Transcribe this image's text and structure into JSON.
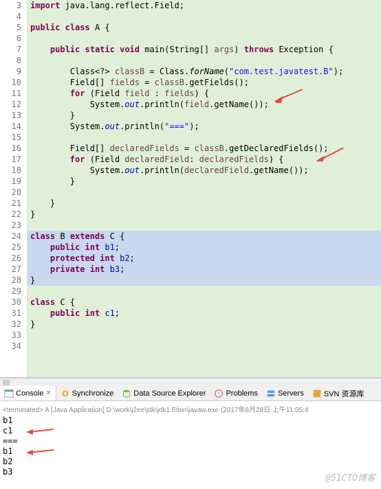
{
  "code": {
    "lines": [
      {
        "n": 3,
        "t": [
          {
            "c": "kw",
            "s": "import"
          },
          {
            "c": "",
            "s": " java.lang.reflect.Field;"
          }
        ]
      },
      {
        "n": 4,
        "t": []
      },
      {
        "n": 5,
        "t": [
          {
            "c": "kw",
            "s": "public"
          },
          {
            "c": "",
            "s": " "
          },
          {
            "c": "kw",
            "s": "class"
          },
          {
            "c": "",
            "s": " A {"
          }
        ]
      },
      {
        "n": 6,
        "t": []
      },
      {
        "n": 7,
        "t": [
          {
            "c": "",
            "s": "    "
          },
          {
            "c": "kw",
            "s": "public"
          },
          {
            "c": "",
            "s": " "
          },
          {
            "c": "kw",
            "s": "static"
          },
          {
            "c": "",
            "s": " "
          },
          {
            "c": "kw",
            "s": "void"
          },
          {
            "c": "",
            "s": " main(String[] "
          },
          {
            "c": "var",
            "s": "args"
          },
          {
            "c": "",
            "s": ") "
          },
          {
            "c": "kw",
            "s": "throws"
          },
          {
            "c": "",
            "s": " Exception {"
          }
        ]
      },
      {
        "n": 8,
        "t": []
      },
      {
        "n": 9,
        "t": [
          {
            "c": "",
            "s": "        Class<?> "
          },
          {
            "c": "var",
            "s": "classB"
          },
          {
            "c": "",
            "s": " = Class."
          },
          {
            "c": "method",
            "s": "forName"
          },
          {
            "c": "",
            "s": "("
          },
          {
            "c": "str",
            "s": "\"com.test.javatest.B\""
          },
          {
            "c": "",
            "s": ");"
          }
        ]
      },
      {
        "n": 10,
        "t": [
          {
            "c": "",
            "s": "        Field[] "
          },
          {
            "c": "var",
            "s": "fields"
          },
          {
            "c": "",
            "s": " = "
          },
          {
            "c": "var",
            "s": "classB"
          },
          {
            "c": "",
            "s": ".getFields();"
          }
        ]
      },
      {
        "n": 11,
        "t": [
          {
            "c": "",
            "s": "        "
          },
          {
            "c": "kw",
            "s": "for"
          },
          {
            "c": "",
            "s": " (Field "
          },
          {
            "c": "var",
            "s": "field"
          },
          {
            "c": "",
            "s": " : "
          },
          {
            "c": "var",
            "s": "fields"
          },
          {
            "c": "",
            "s": ") {"
          }
        ]
      },
      {
        "n": 12,
        "t": [
          {
            "c": "",
            "s": "            System."
          },
          {
            "c": "static",
            "s": "out"
          },
          {
            "c": "",
            "s": ".println("
          },
          {
            "c": "var",
            "s": "field"
          },
          {
            "c": "",
            "s": ".getName());"
          }
        ]
      },
      {
        "n": 13,
        "t": [
          {
            "c": "",
            "s": "        }"
          }
        ]
      },
      {
        "n": 14,
        "t": [
          {
            "c": "",
            "s": "        System."
          },
          {
            "c": "static",
            "s": "out"
          },
          {
            "c": "",
            "s": ".println("
          },
          {
            "c": "str",
            "s": "\"===\""
          },
          {
            "c": "",
            "s": ");"
          }
        ]
      },
      {
        "n": 15,
        "t": []
      },
      {
        "n": 16,
        "t": [
          {
            "c": "",
            "s": "        Field[] "
          },
          {
            "c": "var",
            "s": "declaredFields"
          },
          {
            "c": "",
            "s": " = "
          },
          {
            "c": "var",
            "s": "classB"
          },
          {
            "c": "",
            "s": ".getDeclaredFields();"
          }
        ]
      },
      {
        "n": 17,
        "t": [
          {
            "c": "",
            "s": "        "
          },
          {
            "c": "kw",
            "s": "for"
          },
          {
            "c": "",
            "s": " (Field "
          },
          {
            "c": "var",
            "s": "declaredField"
          },
          {
            "c": "",
            "s": ": "
          },
          {
            "c": "var",
            "s": "declaredFields"
          },
          {
            "c": "",
            "s": ") {"
          }
        ]
      },
      {
        "n": 18,
        "t": [
          {
            "c": "",
            "s": "            System."
          },
          {
            "c": "static",
            "s": "out"
          },
          {
            "c": "",
            "s": ".println("
          },
          {
            "c": "var",
            "s": "declaredField"
          },
          {
            "c": "",
            "s": ".getName());"
          }
        ]
      },
      {
        "n": 19,
        "t": [
          {
            "c": "",
            "s": "        }"
          }
        ]
      },
      {
        "n": 20,
        "t": []
      },
      {
        "n": 21,
        "t": [
          {
            "c": "",
            "s": "    }"
          }
        ]
      },
      {
        "n": 22,
        "t": [
          {
            "c": "",
            "s": "}"
          }
        ]
      },
      {
        "n": 23,
        "t": []
      },
      {
        "n": 24,
        "hl": true,
        "t": [
          {
            "c": "kw",
            "s": "class"
          },
          {
            "c": "",
            "s": " B "
          },
          {
            "c": "kw",
            "s": "extends"
          },
          {
            "c": "",
            "s": " C {"
          }
        ]
      },
      {
        "n": 25,
        "hl": true,
        "t": [
          {
            "c": "",
            "s": "    "
          },
          {
            "c": "kw",
            "s": "public"
          },
          {
            "c": "",
            "s": " "
          },
          {
            "c": "kw",
            "s": "int"
          },
          {
            "c": "",
            "s": " "
          },
          {
            "c": "field",
            "s": "b1"
          },
          {
            "c": "",
            "s": ";"
          }
        ]
      },
      {
        "n": 26,
        "hl": true,
        "t": [
          {
            "c": "",
            "s": "    "
          },
          {
            "c": "kw",
            "s": "protected"
          },
          {
            "c": "",
            "s": " "
          },
          {
            "c": "kw",
            "s": "int"
          },
          {
            "c": "",
            "s": " "
          },
          {
            "c": "field",
            "s": "b2"
          },
          {
            "c": "",
            "s": ";"
          }
        ]
      },
      {
        "n": 27,
        "hl": true,
        "t": [
          {
            "c": "",
            "s": "    "
          },
          {
            "c": "kw",
            "s": "private"
          },
          {
            "c": "",
            "s": " "
          },
          {
            "c": "kw",
            "s": "int"
          },
          {
            "c": "",
            "s": " "
          },
          {
            "c": "field",
            "s": "b3"
          },
          {
            "c": "",
            "s": ";"
          }
        ]
      },
      {
        "n": 28,
        "hl": true,
        "t": [
          {
            "c": "",
            "s": "}"
          }
        ]
      },
      {
        "n": 29,
        "t": []
      },
      {
        "n": 30,
        "t": [
          {
            "c": "kw",
            "s": "class"
          },
          {
            "c": "",
            "s": " C {"
          }
        ]
      },
      {
        "n": 31,
        "t": [
          {
            "c": "",
            "s": "    "
          },
          {
            "c": "kw",
            "s": "public"
          },
          {
            "c": "",
            "s": " "
          },
          {
            "c": "kw",
            "s": "int"
          },
          {
            "c": "",
            "s": " "
          },
          {
            "c": "field",
            "s": "c1"
          },
          {
            "c": "",
            "s": ";"
          }
        ]
      },
      {
        "n": 32,
        "t": [
          {
            "c": "",
            "s": "}"
          }
        ]
      },
      {
        "n": 33,
        "t": []
      },
      {
        "n": 34,
        "t": []
      }
    ]
  },
  "tabs": {
    "console": "Console",
    "sync": "Synchronize",
    "dse": "Data Source Explorer",
    "problems": "Problems",
    "servers": "Servers",
    "svn": "SVN 资源库"
  },
  "console": {
    "header": "<terminated> A [Java Application] D:\\work\\j2ee\\jdk\\jdk1.5\\bin\\javaw.exe (2017年8月28日 上午11:05:4",
    "lines": [
      "b1",
      "c1",
      "===",
      "b1",
      "b2",
      "b3"
    ]
  },
  "watermark": "@51CTO博客"
}
